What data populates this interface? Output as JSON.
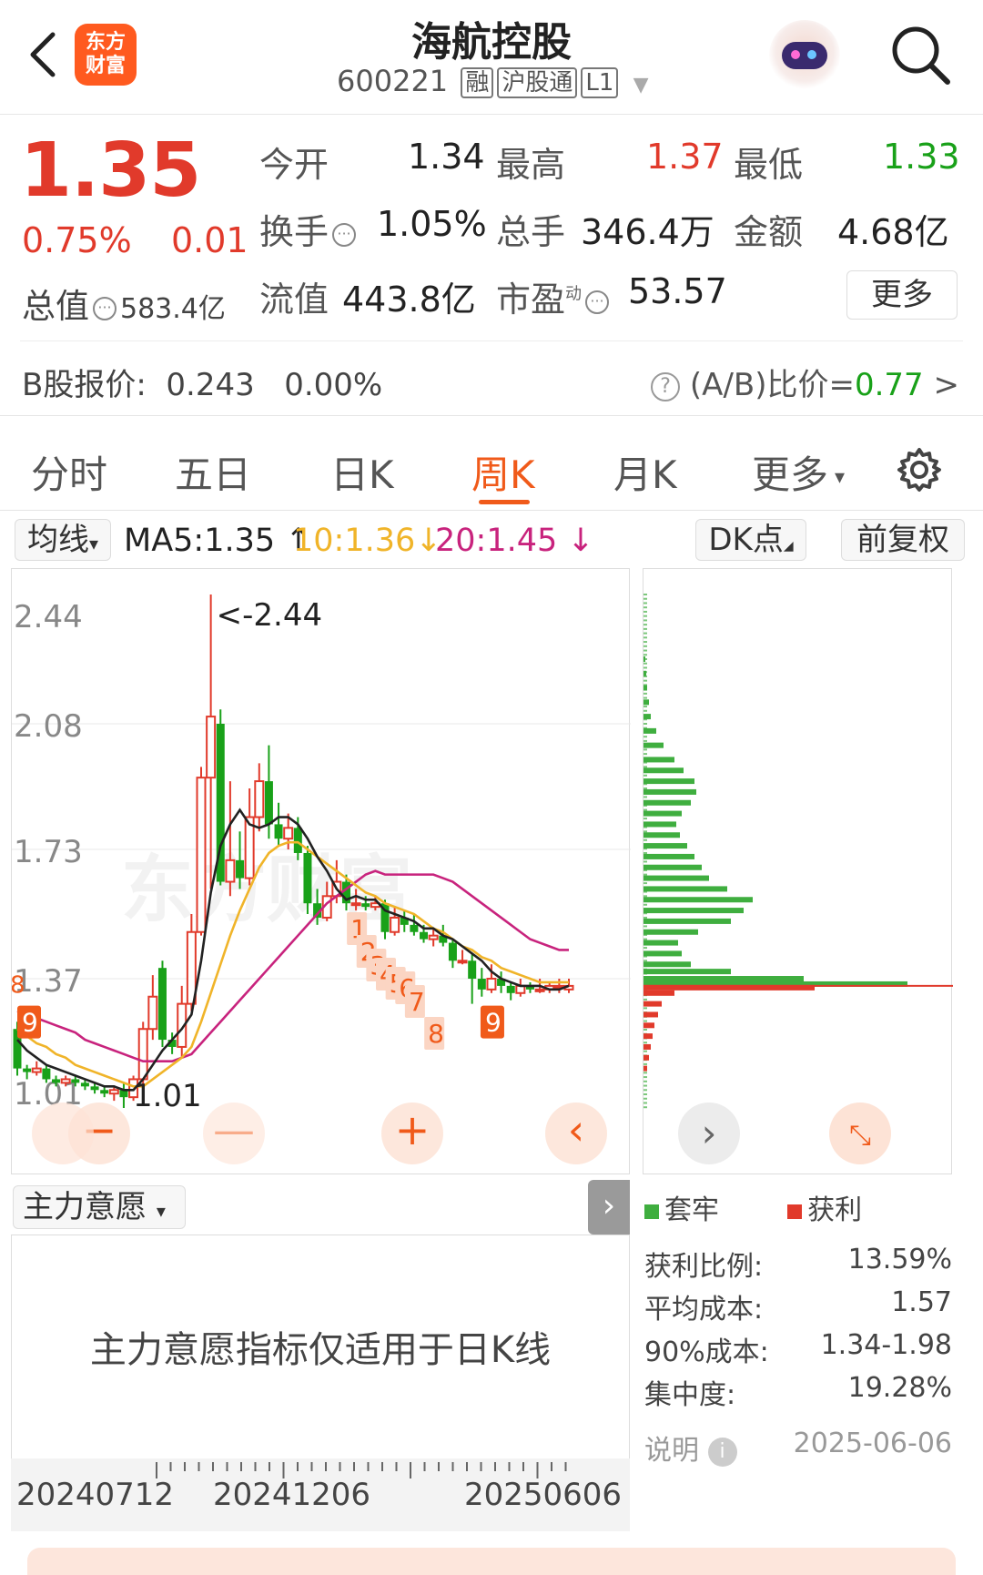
{
  "header": {
    "title": "海航控股",
    "code": "600221",
    "tags": [
      "融",
      "沪股通",
      "L1"
    ],
    "logo_text": "东方财富"
  },
  "quote": {
    "price": "1.35",
    "pct": "0.75%",
    "change": "0.01",
    "mktcap_label": "总值",
    "mktcap_value": "583.4亿",
    "open_label": "今开",
    "open": "1.34",
    "high_label": "最高",
    "high": "1.37",
    "low_label": "最低",
    "low": "1.33",
    "turnover_label": "换手",
    "turnover": "1.05%",
    "volume_label": "总手",
    "volume": "346.4万",
    "amount_label": "金额",
    "amount": "4.68亿",
    "float_label": "流值",
    "float": "443.8亿",
    "pe_label": "市盈",
    "pe_sup": "动",
    "pe": "53.57",
    "more": "更多",
    "b_label": "B股报价:",
    "b_price": "0.243",
    "b_pct": "0.00%",
    "ab_label": "(A/B)比价=",
    "ab_value": "0.77"
  },
  "tabs": [
    "分时",
    "五日",
    "日K",
    "周K",
    "月K",
    "更多"
  ],
  "active_tab": "周K",
  "ma_row": {
    "dropdown": "均线",
    "ma5": "MA5:1.35",
    "ma10": "10:1.36",
    "ma20": "20:1.45",
    "dk": "DK点",
    "fq": "前复权"
  },
  "colors": {
    "up": "#e13a2b",
    "down": "#19a119",
    "ma5": "#222222",
    "ma10": "#f0b429",
    "ma20": "#c8237d",
    "accent": "#f05a1a"
  },
  "chart_data": {
    "type": "candlestick",
    "y_ticks": [
      "2.44",
      "2.08",
      "1.73",
      "1.37",
      "1.01"
    ],
    "max_label": "<-2.44",
    "min_label": "1.01",
    "x_labels": [
      "20240712",
      "20241206",
      "20250606"
    ],
    "td_marks_top": [
      "1",
      "2",
      "3",
      "4",
      "5",
      "6",
      "7",
      "8"
    ],
    "td_marks_left": [
      "8",
      "9"
    ],
    "td_mark_bottom": "9",
    "candles": [
      {
        "o": 1.23,
        "h": 1.25,
        "l": 1.1,
        "c": 1.12
      },
      {
        "o": 1.12,
        "h": 1.13,
        "l": 1.09,
        "c": 1.11
      },
      {
        "o": 1.11,
        "h": 1.14,
        "l": 1.1,
        "c": 1.12
      },
      {
        "o": 1.12,
        "h": 1.13,
        "l": 1.08,
        "c": 1.09
      },
      {
        "o": 1.09,
        "h": 1.1,
        "l": 1.07,
        "c": 1.08
      },
      {
        "o": 1.08,
        "h": 1.1,
        "l": 1.07,
        "c": 1.09
      },
      {
        "o": 1.09,
        "h": 1.1,
        "l": 1.07,
        "c": 1.08
      },
      {
        "o": 1.08,
        "h": 1.09,
        "l": 1.06,
        "c": 1.07
      },
      {
        "o": 1.07,
        "h": 1.08,
        "l": 1.05,
        "c": 1.06
      },
      {
        "o": 1.06,
        "h": 1.07,
        "l": 1.04,
        "c": 1.05
      },
      {
        "o": 1.05,
        "h": 1.07,
        "l": 1.03,
        "c": 1.06
      },
      {
        "o": 1.06,
        "h": 1.08,
        "l": 1.01,
        "c": 1.04
      },
      {
        "o": 1.04,
        "h": 1.1,
        "l": 1.03,
        "c": 1.09
      },
      {
        "o": 1.09,
        "h": 1.25,
        "l": 1.06,
        "c": 1.23
      },
      {
        "o": 1.23,
        "h": 1.38,
        "l": 1.2,
        "c": 1.32
      },
      {
        "o": 1.4,
        "h": 1.42,
        "l": 1.18,
        "c": 1.2
      },
      {
        "o": 1.2,
        "h": 1.22,
        "l": 1.16,
        "c": 1.18
      },
      {
        "o": 1.18,
        "h": 1.35,
        "l": 1.15,
        "c": 1.3
      },
      {
        "o": 1.3,
        "h": 1.55,
        "l": 1.28,
        "c": 1.5
      },
      {
        "o": 1.5,
        "h": 1.96,
        "l": 1.49,
        "c": 1.93
      },
      {
        "o": 1.93,
        "h": 2.44,
        "l": 1.62,
        "c": 2.1
      },
      {
        "o": 2.08,
        "h": 2.12,
        "l": 1.63,
        "c": 1.64
      },
      {
        "o": 1.64,
        "h": 1.92,
        "l": 1.6,
        "c": 1.7
      },
      {
        "o": 1.7,
        "h": 1.78,
        "l": 1.62,
        "c": 1.65
      },
      {
        "o": 1.65,
        "h": 1.9,
        "l": 1.63,
        "c": 1.82
      },
      {
        "o": 1.82,
        "h": 1.97,
        "l": 1.78,
        "c": 1.92
      },
      {
        "o": 1.92,
        "h": 2.02,
        "l": 1.76,
        "c": 1.8
      },
      {
        "o": 1.8,
        "h": 1.86,
        "l": 1.74,
        "c": 1.76
      },
      {
        "o": 1.76,
        "h": 1.83,
        "l": 1.73,
        "c": 1.79
      },
      {
        "o": 1.79,
        "h": 1.82,
        "l": 1.7,
        "c": 1.72
      },
      {
        "o": 1.72,
        "h": 1.74,
        "l": 1.55,
        "c": 1.58
      },
      {
        "o": 1.58,
        "h": 1.62,
        "l": 1.52,
        "c": 1.54
      },
      {
        "o": 1.54,
        "h": 1.64,
        "l": 1.53,
        "c": 1.6
      },
      {
        "o": 1.6,
        "h": 1.7,
        "l": 1.58,
        "c": 1.64
      },
      {
        "o": 1.64,
        "h": 1.66,
        "l": 1.56,
        "c": 1.58
      },
      {
        "o": 1.58,
        "h": 1.62,
        "l": 1.56,
        "c": 1.58
      },
      {
        "o": 1.58,
        "h": 1.6,
        "l": 1.56,
        "c": 1.57
      },
      {
        "o": 1.57,
        "h": 1.6,
        "l": 1.56,
        "c": 1.58
      },
      {
        "o": 1.58,
        "h": 1.59,
        "l": 1.48,
        "c": 1.5
      },
      {
        "o": 1.5,
        "h": 1.57,
        "l": 1.49,
        "c": 1.54
      },
      {
        "o": 1.54,
        "h": 1.56,
        "l": 1.5,
        "c": 1.52
      },
      {
        "o": 1.52,
        "h": 1.55,
        "l": 1.49,
        "c": 1.5
      },
      {
        "o": 1.5,
        "h": 1.52,
        "l": 1.47,
        "c": 1.48
      },
      {
        "o": 1.48,
        "h": 1.51,
        "l": 1.46,
        "c": 1.49
      },
      {
        "o": 1.49,
        "h": 1.52,
        "l": 1.46,
        "c": 1.47
      },
      {
        "o": 1.47,
        "h": 1.48,
        "l": 1.4,
        "c": 1.42
      },
      {
        "o": 1.42,
        "h": 1.45,
        "l": 1.41,
        "c": 1.42
      },
      {
        "o": 1.42,
        "h": 1.44,
        "l": 1.3,
        "c": 1.37
      },
      {
        "o": 1.37,
        "h": 1.4,
        "l": 1.32,
        "c": 1.34
      },
      {
        "o": 1.34,
        "h": 1.41,
        "l": 1.33,
        "c": 1.37
      },
      {
        "o": 1.37,
        "h": 1.39,
        "l": 1.33,
        "c": 1.35
      },
      {
        "o": 1.35,
        "h": 1.36,
        "l": 1.31,
        "c": 1.33
      },
      {
        "o": 1.33,
        "h": 1.37,
        "l": 1.32,
        "c": 1.35
      },
      {
        "o": 1.35,
        "h": 1.36,
        "l": 1.33,
        "c": 1.34
      },
      {
        "o": 1.34,
        "h": 1.37,
        "l": 1.33,
        "c": 1.34
      },
      {
        "o": 1.34,
        "h": 1.36,
        "l": 1.33,
        "c": 1.35
      },
      {
        "o": 1.35,
        "h": 1.37,
        "l": 1.33,
        "c": 1.35
      },
      {
        "o": 1.34,
        "h": 1.37,
        "l": 1.33,
        "c": 1.35
      }
    ],
    "ma5": [
      1.2,
      1.17,
      1.15,
      1.13,
      1.12,
      1.11,
      1.1,
      1.09,
      1.08,
      1.07,
      1.07,
      1.06,
      1.06,
      1.09,
      1.13,
      1.17,
      1.2,
      1.23,
      1.27,
      1.42,
      1.61,
      1.74,
      1.8,
      1.84,
      1.8,
      1.79,
      1.8,
      1.82,
      1.82,
      1.8,
      1.76,
      1.71,
      1.67,
      1.62,
      1.59,
      1.6,
      1.59,
      1.59,
      1.56,
      1.55,
      1.54,
      1.53,
      1.51,
      1.51,
      1.49,
      1.48,
      1.46,
      1.44,
      1.42,
      1.39,
      1.37,
      1.36,
      1.35,
      1.35,
      1.35,
      1.34,
      1.34,
      1.35
    ],
    "ma10": [
      1.23,
      1.21,
      1.19,
      1.18,
      1.16,
      1.15,
      1.13,
      1.12,
      1.11,
      1.1,
      1.09,
      1.08,
      1.07,
      1.07,
      1.09,
      1.11,
      1.13,
      1.15,
      1.18,
      1.25,
      1.33,
      1.41,
      1.49,
      1.56,
      1.62,
      1.68,
      1.72,
      1.74,
      1.75,
      1.75,
      1.73,
      1.71,
      1.69,
      1.67,
      1.65,
      1.63,
      1.61,
      1.6,
      1.58,
      1.57,
      1.56,
      1.55,
      1.53,
      1.51,
      1.5,
      1.48,
      1.46,
      1.45,
      1.43,
      1.42,
      1.4,
      1.39,
      1.38,
      1.37,
      1.36,
      1.36,
      1.36,
      1.36
    ],
    "ma20": [
      1.28,
      1.27,
      1.26,
      1.25,
      1.24,
      1.23,
      1.22,
      1.2,
      1.19,
      1.18,
      1.17,
      1.16,
      1.15,
      1.14,
      1.14,
      1.14,
      1.14,
      1.15,
      1.16,
      1.19,
      1.22,
      1.25,
      1.28,
      1.31,
      1.34,
      1.37,
      1.4,
      1.43,
      1.46,
      1.49,
      1.52,
      1.55,
      1.58,
      1.6,
      1.62,
      1.64,
      1.66,
      1.67,
      1.66,
      1.66,
      1.66,
      1.66,
      1.66,
      1.66,
      1.65,
      1.64,
      1.62,
      1.6,
      1.58,
      1.56,
      1.54,
      1.52,
      1.5,
      1.48,
      1.47,
      1.46,
      1.45,
      1.45
    ],
    "chip_profile": [
      {
        "price": 2.26,
        "w": 2
      },
      {
        "price": 2.22,
        "w": 3
      },
      {
        "price": 2.18,
        "w": 4
      },
      {
        "price": 2.14,
        "w": 6
      },
      {
        "price": 2.1,
        "w": 8
      },
      {
        "price": 2.06,
        "w": 14
      },
      {
        "price": 2.02,
        "w": 22
      },
      {
        "price": 1.98,
        "w": 34
      },
      {
        "price": 1.95,
        "w": 44
      },
      {
        "price": 1.92,
        "w": 56
      },
      {
        "price": 1.89,
        "w": 58
      },
      {
        "price": 1.86,
        "w": 52
      },
      {
        "price": 1.83,
        "w": 42
      },
      {
        "price": 1.8,
        "w": 36
      },
      {
        "price": 1.77,
        "w": 40
      },
      {
        "price": 1.74,
        "w": 48
      },
      {
        "price": 1.71,
        "w": 56
      },
      {
        "price": 1.68,
        "w": 64
      },
      {
        "price": 1.65,
        "w": 72
      },
      {
        "price": 1.62,
        "w": 92
      },
      {
        "price": 1.59,
        "w": 120
      },
      {
        "price": 1.56,
        "w": 110
      },
      {
        "price": 1.53,
        "w": 96
      },
      {
        "price": 1.5,
        "w": 60
      },
      {
        "price": 1.47,
        "w": 38
      },
      {
        "price": 1.44,
        "w": 42
      },
      {
        "price": 1.41,
        "w": 52
      },
      {
        "price": 1.39,
        "w": 96
      },
      {
        "price": 1.37,
        "w": 176
      },
      {
        "price": 1.355,
        "w": 290
      },
      {
        "price": 1.345,
        "w": 188
      },
      {
        "price": 1.33,
        "w": 34
      },
      {
        "price": 1.3,
        "w": 20
      },
      {
        "price": 1.27,
        "w": 16
      },
      {
        "price": 1.24,
        "w": 12
      },
      {
        "price": 1.21,
        "w": 10
      },
      {
        "price": 1.18,
        "w": 8
      },
      {
        "price": 1.15,
        "w": 6
      },
      {
        "price": 1.12,
        "w": 4
      }
    ],
    "ylim": [
      1.01,
      2.44
    ]
  },
  "indicator": {
    "dropdown": "主力意愿",
    "message": "主力意愿指标仅适用于日K线"
  },
  "chips": {
    "legend_trap": "套牢",
    "legend_profit": "获利",
    "profit_ratio_label": "获利比例:",
    "profit_ratio": "13.59%",
    "avg_cost_label": "平均成本:",
    "avg_cost": "1.57",
    "cost90_label": "90%成本:",
    "cost90": "1.34-1.98",
    "concentration_label": "集中度:",
    "concentration": "19.28%",
    "note_label": "说明",
    "date": "2025-06-06"
  },
  "watermark": "东方财富"
}
